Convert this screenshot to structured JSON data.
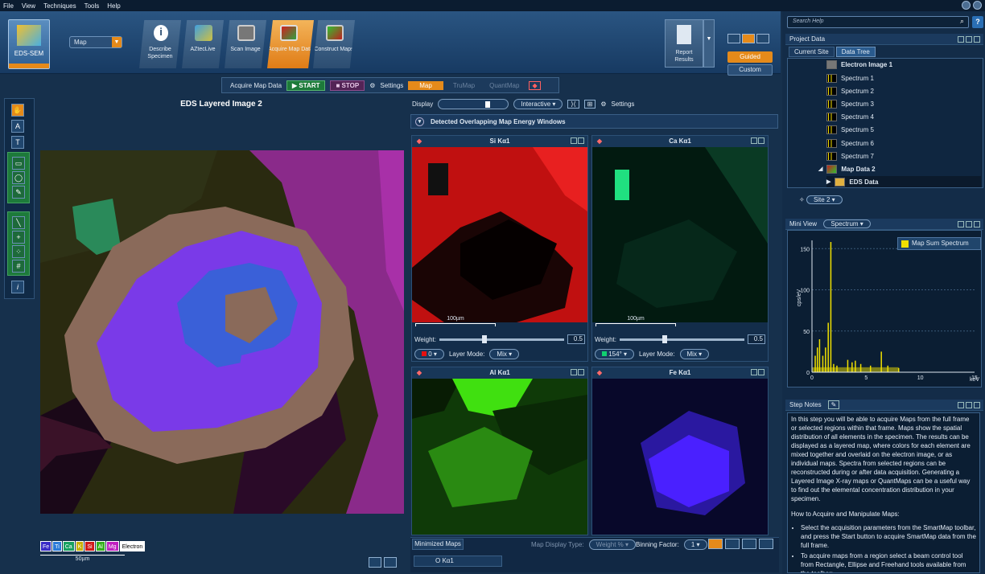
{
  "menu": [
    "File",
    "View",
    "Techniques",
    "Tools",
    "Help"
  ],
  "app": {
    "name": "EDS-SEM",
    "mode": "Map"
  },
  "steps": [
    {
      "label": "Describe Specimen",
      "icon": "info-icon"
    },
    {
      "label": "AZtecLive",
      "icon": "aztec-live-icon"
    },
    {
      "label": "Scan Image",
      "icon": "scan-image-icon"
    },
    {
      "label": "Acquire Map Data",
      "icon": "acquire-map-icon",
      "active": true
    },
    {
      "label": "Construct Maps",
      "icon": "construct-maps-icon"
    }
  ],
  "report": {
    "label": "Report Results"
  },
  "guided_label": "Guided",
  "custom_label": "Custom",
  "acq": {
    "label": "Acquire Map Data",
    "start": "START",
    "stop": "STOP",
    "settings": "Settings",
    "map": "Map",
    "trumap": "TruMap",
    "quantmap": "QuantMap"
  },
  "eds": {
    "title": "EDS Layered Image 2",
    "scale": "50µm",
    "legend": [
      {
        "el": "Fe",
        "color": "#3a2cc6"
      },
      {
        "el": "Ti",
        "color": "#2a7ad8"
      },
      {
        "el": "Ca",
        "color": "#18a060"
      },
      {
        "el": "K",
        "color": "#c8b000"
      },
      {
        "el": "Si",
        "color": "#d01818"
      },
      {
        "el": "Al",
        "color": "#32b01a"
      },
      {
        "el": "Mg",
        "color": "#c020c0"
      },
      {
        "el": "Electron",
        "color": "#ffffff"
      }
    ]
  },
  "display": {
    "label": "Display",
    "mode": "Interactive",
    "settings": "Settings"
  },
  "detected": "Detected Overlapping Map Energy Windows",
  "maps": [
    {
      "title": "Si Kα1",
      "scale": "100µm",
      "weight_label": "Weight:",
      "weight": "0.5",
      "color_val": "0",
      "layer_label": "Layer Mode:",
      "layer": "Mix",
      "color": "#e81010"
    },
    {
      "title": "Ca Kα1",
      "scale": "100µm",
      "weight_label": "Weight:",
      "weight": "0.5",
      "color_val": "154°",
      "layer_label": "Layer Mode:",
      "layer": "Mix",
      "color": "#10d070"
    },
    {
      "title": "Al Kα1",
      "color": "#40e010"
    },
    {
      "title": "Fe Kα1",
      "color": "#4a20ff"
    }
  ],
  "minimized": {
    "tab": "Minimized Maps",
    "item": "O Kα1",
    "display_type_label": "Map Display Type:",
    "display_type": "Weight %",
    "binning_label": "Binning Factor:",
    "binning": "1"
  },
  "right": {
    "search_placeholder": "Search Help",
    "project_data": "Project Data",
    "tabs": [
      "Current Site",
      "Data Tree"
    ],
    "tree": [
      {
        "label": "Electron Image 1",
        "bold": true
      },
      {
        "label": "Spectrum 1"
      },
      {
        "label": "Spectrum 2"
      },
      {
        "label": "Spectrum 3"
      },
      {
        "label": "Spectrum 4"
      },
      {
        "label": "Spectrum 5"
      },
      {
        "label": "Spectrum 6"
      },
      {
        "label": "Spectrum 7"
      },
      {
        "label": "Map Data 2",
        "bold": true
      },
      {
        "label": "EDS Data",
        "bold": true
      }
    ],
    "site": "Site 2",
    "mini_view": "Mini View",
    "mini_mode": "Spectrum",
    "series": "Map Sum Spectrum",
    "y_axis": "cps/eV",
    "x_axis": "keV",
    "step_notes": "Step Notes",
    "notes_p1": "In this step you will be able to acquire Maps from the full frame or selected regions within that frame. Maps show the spatial distribution of all elements in the specimen. The results can be displayed as a layered map, where colors for each element are mixed together and overlaid on the electron image, or as individual maps. Spectra from selected regions can be reconstructed during or after data acquisition. Generating a Layered Image X-ray maps or QuantMaps can be a useful way to find out the elemental concentration distribution in your specimen.",
    "notes_h": "How to Acquire and Manipulate Maps:",
    "notes_b1": "Select the acquisition parameters from the SmartMap toolbar, and press the Start button to acquire SmartMap data from the full frame.",
    "notes_b2": "To acquire maps from a region select a beam control tool from Rectangle, Ellipse and Freehand tools available from the toolbar:"
  },
  "chart_data": {
    "type": "line",
    "title": "",
    "xlabel": "keV",
    "ylabel": "cps/eV",
    "xlim": [
      0,
      15
    ],
    "ylim": [
      0,
      160
    ],
    "x_ticks": [
      0,
      5,
      10,
      15
    ],
    "y_ticks": [
      0,
      50,
      100,
      150
    ],
    "series": [
      {
        "name": "Map Sum Spectrum",
        "color": "#f0e000",
        "x": [
          0.3,
          0.5,
          0.7,
          1.0,
          1.25,
          1.5,
          1.74,
          2.0,
          2.3,
          3.3,
          3.7,
          4.0,
          4.5,
          5.4,
          6.4,
          7.0,
          8.0
        ],
        "y": [
          20,
          30,
          40,
          20,
          30,
          60,
          158,
          10,
          8,
          15,
          12,
          14,
          10,
          8,
          25,
          8,
          5
        ]
      }
    ]
  }
}
